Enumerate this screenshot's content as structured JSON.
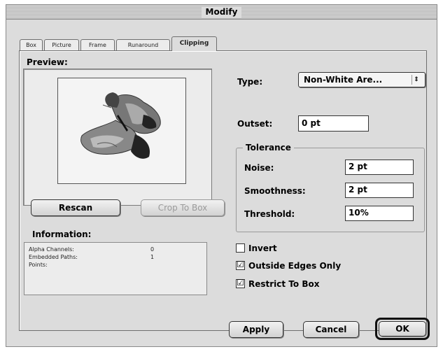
{
  "window": {
    "title": "Modify"
  },
  "tabs": [
    {
      "label": "Box"
    },
    {
      "label": "Picture"
    },
    {
      "label": "Frame"
    },
    {
      "label": "Runaround"
    },
    {
      "label": "Clipping"
    }
  ],
  "active_tab": "Clipping",
  "preview": {
    "label": "Preview:",
    "image": "butterfly"
  },
  "buttons": {
    "rescan": "Rescan",
    "crop_to_box": "Crop To Box",
    "apply": "Apply",
    "cancel": "Cancel",
    "ok": "OK"
  },
  "information": {
    "label": "Information:",
    "rows": [
      {
        "name": "Alpha Channels:",
        "value": "0"
      },
      {
        "name": "Embedded Paths:",
        "value": "1"
      },
      {
        "name": "Points:",
        "value": ""
      }
    ]
  },
  "type": {
    "label": "Type:",
    "selected": "Non-White Are...",
    "arrows": "⇕"
  },
  "outset": {
    "label": "Outset:",
    "value": "0 pt"
  },
  "tolerance": {
    "title": "Tolerance",
    "noise_label": "Noise:",
    "noise_value": "2 pt",
    "smoothness_label": "Smoothness:",
    "smoothness_value": "2 pt",
    "threshold_label": "Threshold:",
    "threshold_value": "10%"
  },
  "options": {
    "invert_label": "Invert",
    "invert_checked": false,
    "outside_edges_label": "Outside Edges Only",
    "outside_edges_checked": true,
    "restrict_label": "Restrict To Box",
    "restrict_checked": true,
    "check_mark": "☑"
  },
  "colors": {
    "dialog_bg": "#dcdcdc",
    "field_bg": "#ffffff",
    "border": "#333333"
  }
}
